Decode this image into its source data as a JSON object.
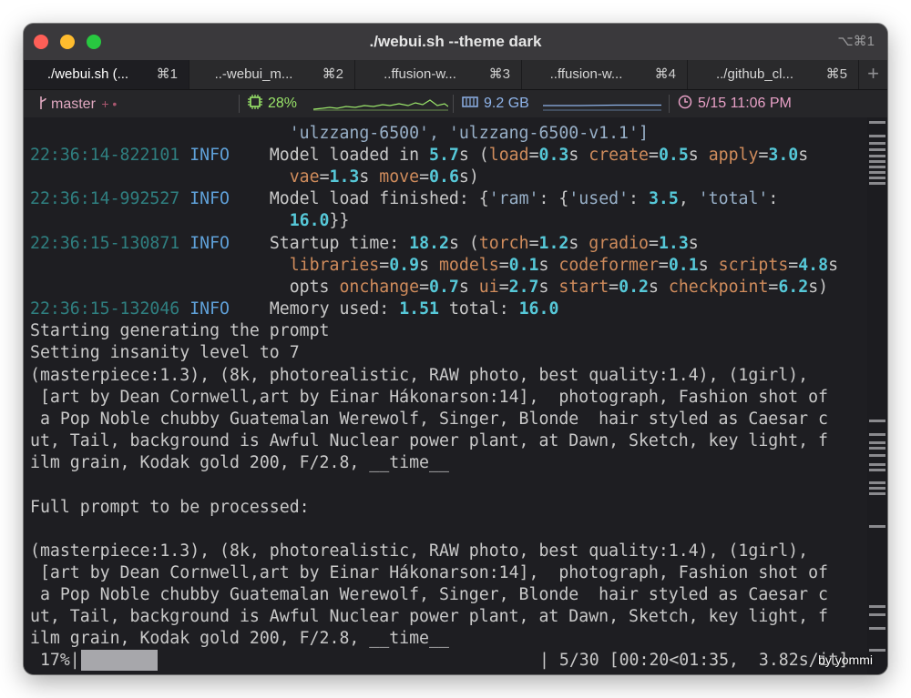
{
  "window": {
    "title": "./webui.sh --theme dark",
    "shortcut": "⌥⌘1"
  },
  "tabs": [
    {
      "label": "./webui.sh (...",
      "shortcut": "⌘1",
      "active": true
    },
    {
      "label": "..-webui_m...",
      "shortcut": "⌘2",
      "active": false
    },
    {
      "label": "..ffusion-w...",
      "shortcut": "⌘3",
      "active": false
    },
    {
      "label": "..ffusion-w...",
      "shortcut": "⌘4",
      "active": false
    },
    {
      "label": "../github_cl...",
      "shortcut": "⌘5",
      "active": false
    }
  ],
  "new_tab_label": "+",
  "status": {
    "branch_icon": "git-branch-icon",
    "branch": "master",
    "git_dirty": "+ •",
    "cpu_icon": "cpu-chip-icon",
    "cpu": "28%",
    "mem_icon": "memory-icon",
    "mem": "9.2 GB",
    "clock_icon": "clock-icon",
    "clock": "5/15 11:06 PM",
    "colors": {
      "branch": "#e0a8c0",
      "cpu": "#9ae56a",
      "mem": "#8fb4ea",
      "clock": "#e7a0c6"
    }
  },
  "log": {
    "l0": "'ulzzang-6500', 'ulzzang-6500-v1.1']",
    "r1": {
      "ts": "22:36:14-822101",
      "lvl": "INFO",
      "t0": "Model loaded in ",
      "n0": "5.7",
      "t1": "s (",
      "k1": "load",
      "e1": "=",
      "n1": "0.3",
      "s1": "s ",
      "k2": "create",
      "e2": "=",
      "n2": "0.5",
      "s2": "s ",
      "k3": "apply",
      "e3": "=",
      "n3": "3.0",
      "s3": "s"
    },
    "r1b": {
      "k1": "vae",
      "e1": "=",
      "n1": "1.3",
      "s1": "s ",
      "k2": "move",
      "e2": "=",
      "n2": "0.6",
      "s2": "s)"
    },
    "r2": {
      "ts": "22:36:14-992527",
      "lvl": "INFO",
      "t0": "Model load finished: ",
      "b1": "{",
      "q1": "'ram'",
      "c1": ": ",
      "b2": "{",
      "q2": "'used'",
      "c2": ": ",
      "n1": "3.5",
      "c3": ", ",
      "q3": "'total'",
      "c4": ":"
    },
    "r2b": {
      "n1": "16.0",
      "b1": "}}"
    },
    "r3": {
      "ts": "22:36:15-130871",
      "lvl": "INFO",
      "t0": "Startup time: ",
      "n0": "18.2",
      "t1": "s (",
      "k1": "torch",
      "e1": "=",
      "n1": "1.2",
      "s1": "s ",
      "k2": "gradio",
      "e2": "=",
      "n2": "1.3",
      "s2": "s"
    },
    "r3b": {
      "k1": "libraries",
      "e1": "=",
      "n1": "0.9",
      "s1": "s ",
      "k2": "models",
      "e2": "=",
      "n2": "0.1",
      "s2": "s ",
      "k3": "codeformer",
      "e3": "=",
      "n3": "0.1",
      "s3": "s ",
      "k4": "scripts",
      "e4": "=",
      "n4": "4.8",
      "s4": "s"
    },
    "r3c": {
      "k1": "opts",
      "s0": " ",
      "k2": "onchange",
      "e2": "=",
      "n2": "0.7",
      "s2": "s ",
      "k3": "ui",
      "e3": "=",
      "n3": "2.7",
      "s3": "s ",
      "k4": "start",
      "e4": "=",
      "n4": "0.2",
      "s4": "s ",
      "k5": "checkpoint",
      "e5": "=",
      "n5": "6.2",
      "s5": "s)"
    },
    "r4": {
      "ts": "22:36:15-132046",
      "lvl": "INFO",
      "t0": "Memory used: ",
      "n0": "1.51",
      "t1": " total: ",
      "n1": "16.0"
    },
    "p1": "Starting generating the prompt",
    "p2": "Setting insanity level to 7",
    "p3": "(masterpiece:1.3), (8k, photorealistic, RAW photo, best quality:1.4), (1girl),",
    "p4": " [art by Dean Cornwell,art by Einar Hákonarson:14],  photograph, Fashion shot of",
    "p5": " a Pop Noble chubby Guatemalan Werewolf, Singer, Blonde  hair styled as Caesar c",
    "p6": "ut, Tail, background is Awful Nuclear power plant, at Dawn, Sketch, key light, f",
    "p7": "ilm grain, Kodak gold 200, F/2.8, __time__",
    "p8": "Full prompt to be processed:",
    "p9": "(masterpiece:1.3), (8k, photorealistic, RAW photo, best quality:1.4), (1girl),",
    "p10": " [art by Dean Cornwell,art by Einar Hákonarson:14],  photograph, Fashion shot of",
    "p11": " a Pop Noble chubby Guatemalan Werewolf, Singer, Blonde  hair styled as Caesar c",
    "p12": "ut, Tail, background is Awful Nuclear power plant, at Dawn, Sketch, key light, f",
    "p13": "ilm grain, Kodak gold 200, F/2.8, __time__"
  },
  "progress": {
    "percent_label": " 17%|",
    "fraction": 0.17,
    "tail": "| 5/30 [00:20<01:35,  3.82s/it]"
  },
  "credit": "by yommi"
}
